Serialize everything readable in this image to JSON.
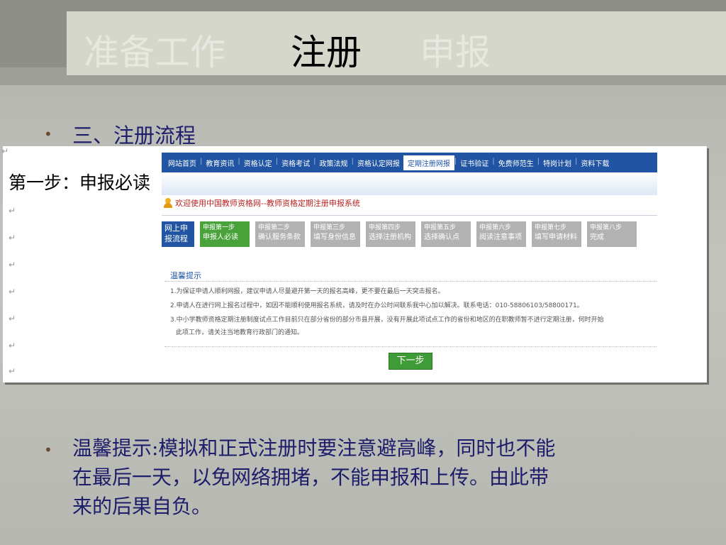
{
  "header": {
    "tabs": [
      {
        "label": "准备工作",
        "state": "inactive"
      },
      {
        "label": "注册",
        "state": "active"
      },
      {
        "label": "申报",
        "state": "inactive"
      }
    ]
  },
  "section_heading": "三、注册流程",
  "screenshot": {
    "step_title": "第一步：申报必读",
    "nav_items": [
      "网站首页",
      "教育资讯",
      "资格认定",
      "资格考试",
      "政策法规",
      "资格认定网报",
      "定期注册网报",
      "证书验证",
      "免费师范生",
      "特岗计划",
      "资料下载"
    ],
    "nav_active": "定期注册网报",
    "welcome_text": "欢迎使用中国教师资格网--教师资格定期注册申报系统",
    "flow_label_line1": "网上申",
    "flow_label_line2": "报流程",
    "flow_steps": [
      {
        "small": "申报第一步",
        "big": "申报人必读"
      },
      {
        "small": "申报第二步",
        "big": "确认服务条款"
      },
      {
        "small": "申报第三步",
        "big": "填写身份信息"
      },
      {
        "small": "申报第四步",
        "big": "选择注册机构"
      },
      {
        "small": "申报第五步",
        "big": "选择确认点"
      },
      {
        "small": "申报第六步",
        "big": "阅读注意事项"
      },
      {
        "small": "申报第七步",
        "big": "填写申请材料"
      },
      {
        "small": "申报第八步",
        "big": "完成"
      }
    ],
    "notice_title": "温馨提示",
    "notices": [
      "1.为保证申请人顺利网报，建议申请人尽量避开第一天的报名高峰，更不要在最后一天突击报名。",
      "2.申请人在进行网上报名过程中，如因不能顺利使用报名系统，请及时在办公时间联系我中心加以解决。联系电话：010-58806103/58800171。",
      "3.中小学教师资格定期注册制度试点工作目前只在部分省份的部分市县开展，没有开展此项试点工作的省份和地区的在职教师暂不进行定期注册，何时开始",
      "此项工作，请关注当地教育行政部门的通知。"
    ],
    "next_button": "下一步"
  },
  "tip_bullet": "温馨提示:模拟和正式注册时要注意避高峰，同时也不能",
  "tip_line2": "在最后一天，以免网络拥堵，不能申报和上传。由此带",
  "tip_line3": "来的后果自负。",
  "colors": {
    "nav_blue": "#2155a3",
    "step_green": "#4aa33a",
    "step_gray": "#b2b2b2",
    "text_navy": "#1d1d6b"
  }
}
